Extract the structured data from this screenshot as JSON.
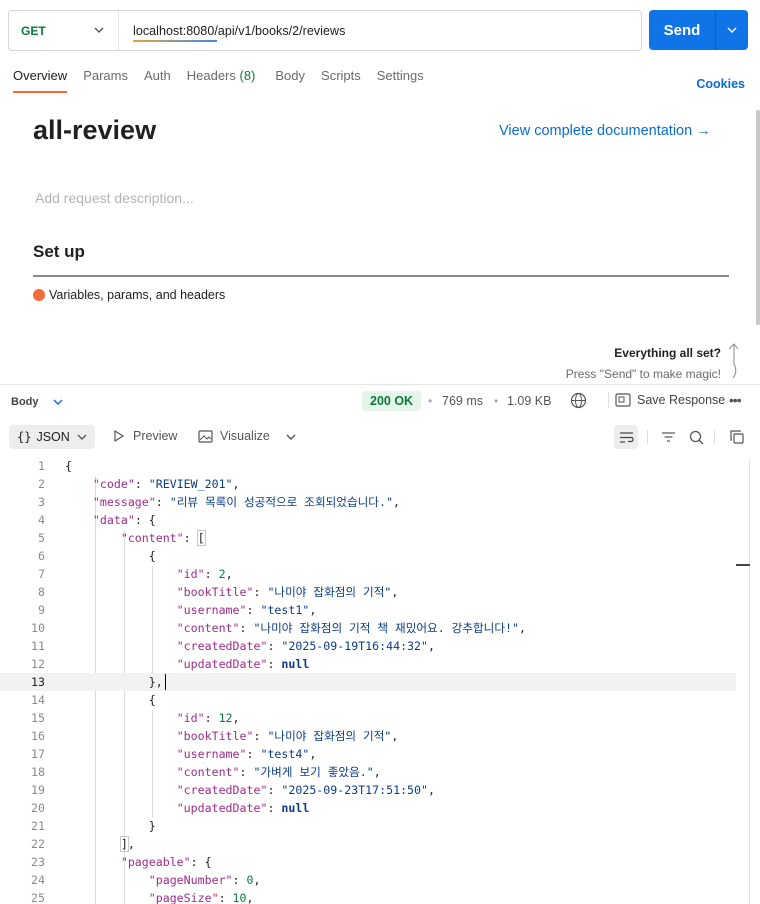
{
  "request": {
    "method": "GET",
    "url": "localhost:8080/api/v1/books/2/reviews",
    "send_label": "Send"
  },
  "tabs": [
    {
      "label": "Overview",
      "active": true
    },
    {
      "label": "Params"
    },
    {
      "label": "Auth"
    },
    {
      "label": "Headers",
      "count": "(8)"
    },
    {
      "label": "Body"
    },
    {
      "label": "Scripts"
    },
    {
      "label": "Settings"
    }
  ],
  "cookies_label": "Cookies",
  "overview": {
    "title": "all-review",
    "doc_link": "View complete documentation →",
    "description_placeholder": "Add request description...",
    "setup_heading": "Set up",
    "setup_item": "Variables, params, and headers",
    "allset_heading": "Everything all set?",
    "allset_sub": "Press \"Send\" to make magic!"
  },
  "response": {
    "body_label": "Body",
    "status": "200 OK",
    "time": "769 ms",
    "size": "1.09 KB",
    "save_label": "Save Response",
    "format": "JSON",
    "preview_label": "Preview",
    "visualize_label": "Visualize"
  },
  "code_lines": [
    {
      "n": "1",
      "html": "{"
    },
    {
      "n": "2",
      "html": "    <span class=\"k\">\"code\"</span>: <span class=\"s\">\"REVIEW_201\"</span>,"
    },
    {
      "n": "3",
      "html": "    <span class=\"k\">\"message\"</span>: <span class=\"s\">\"리뷰 목록이 성공적으로 조회되었습니다.\"</span>,"
    },
    {
      "n": "4",
      "html": "    <span class=\"k\">\"data\"</span>: {"
    },
    {
      "n": "5",
      "html": "        <span class=\"k\">\"content\"</span>: <span class=\"brk\">[</span>"
    },
    {
      "n": "6",
      "html": "            {"
    },
    {
      "n": "7",
      "html": "                <span class=\"k\">\"id\"</span>: <span class=\"n\">2</span>,"
    },
    {
      "n": "8",
      "html": "                <span class=\"k\">\"bookTitle\"</span>: <span class=\"s\">\"나미야 잡화점의 기적\"</span>,"
    },
    {
      "n": "9",
      "html": "                <span class=\"k\">\"username\"</span>: <span class=\"s\">\"test1\"</span>,"
    },
    {
      "n": "10",
      "html": "                <span class=\"k\">\"content\"</span>: <span class=\"s\">\"나미야 잡화점의 기적 책 재밌어요. 강추합니다!\"</span>,"
    },
    {
      "n": "11",
      "html": "                <span class=\"k\">\"createdDate\"</span>: <span class=\"s\">\"2025-09-19T16:44:32\"</span>,"
    },
    {
      "n": "12",
      "html": "                <span class=\"k\">\"updatedDate\"</span>: <span class=\"b\">null</span>"
    },
    {
      "n": "13",
      "html": "            },",
      "hl": true
    },
    {
      "n": "14",
      "html": "            {"
    },
    {
      "n": "15",
      "html": "                <span class=\"k\">\"id\"</span>: <span class=\"n\">12</span>,"
    },
    {
      "n": "16",
      "html": "                <span class=\"k\">\"bookTitle\"</span>: <span class=\"s\">\"나미야 잡화점의 기적\"</span>,"
    },
    {
      "n": "17",
      "html": "                <span class=\"k\">\"username\"</span>: <span class=\"s\">\"test4\"</span>,"
    },
    {
      "n": "18",
      "html": "                <span class=\"k\">\"content\"</span>: <span class=\"s\">\"가벼게 보기 좋았음.\"</span>,"
    },
    {
      "n": "19",
      "html": "                <span class=\"k\">\"createdDate\"</span>: <span class=\"s\">\"2025-09-23T17:51:50\"</span>,"
    },
    {
      "n": "20",
      "html": "                <span class=\"k\">\"updatedDate\"</span>: <span class=\"b\">null</span>"
    },
    {
      "n": "21",
      "html": "            }"
    },
    {
      "n": "22",
      "html": "        <span class=\"brk\">]</span>,"
    },
    {
      "n": "23",
      "html": "        <span class=\"k\">\"pageable\"</span>: {"
    },
    {
      "n": "24",
      "html": "            <span class=\"k\">\"pageNumber\"</span>: <span class=\"n\">0</span>,"
    },
    {
      "n": "25",
      "html": "            <span class=\"k\">\"pageSize\"</span>: <span class=\"n\">10</span>,"
    }
  ]
}
